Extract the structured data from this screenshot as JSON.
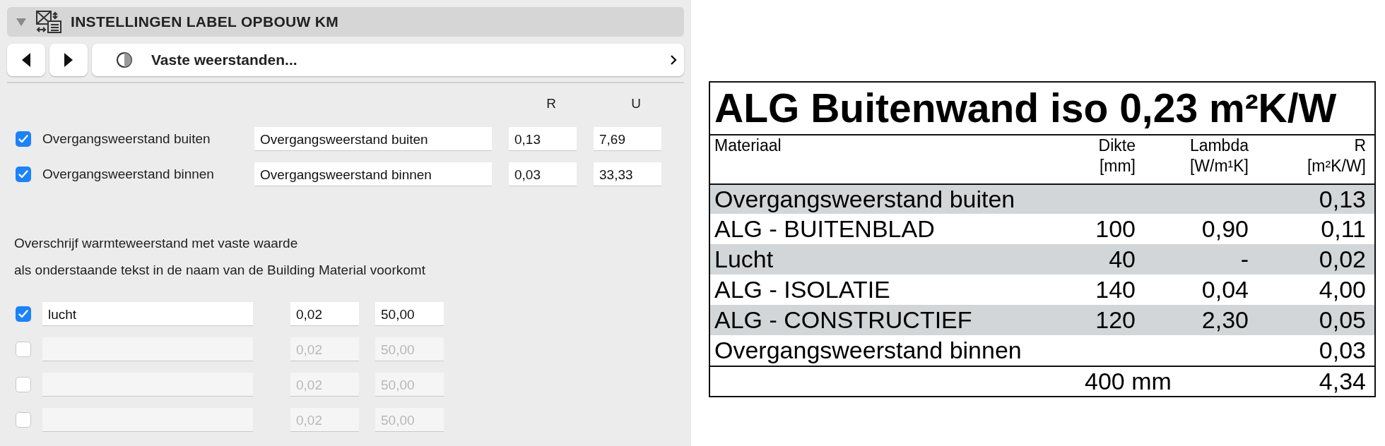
{
  "panel": {
    "title": "INSTELLINGEN LABEL OPBOUW KM",
    "expanded": true,
    "nav": {
      "label": "Vaste weerstanden..."
    },
    "columns": [
      "R",
      "U"
    ],
    "fixed_rows": [
      {
        "label": "Overgangsweerstand buiten",
        "checked": true,
        "name": "Overgangsweerstand buiten",
        "r": "0,13",
        "u": "7,69"
      },
      {
        "label": "Overgangsweerstand binnen",
        "checked": true,
        "name": "Overgangsweerstand binnen",
        "r": "0,03",
        "u": "33,33"
      }
    ],
    "description": [
      "Overschrijf warmteweerstand met vaste waarde",
      "als onderstaande tekst in de naam van de Building Material voorkomt"
    ],
    "override_rows": [
      {
        "checked": true,
        "disabled": false,
        "name": "lucht",
        "r": "0,02",
        "u": "50,00"
      },
      {
        "checked": false,
        "disabled": true,
        "r": "0,02",
        "u": "50,00"
      },
      {
        "checked": false,
        "disabled": true,
        "r": "0,02",
        "u": "50,00"
      },
      {
        "checked": false,
        "disabled": true,
        "r": "0,02",
        "u": "50,00"
      }
    ]
  },
  "label_table": {
    "title": "ALG Buitenwand iso 0,23 m²K/W",
    "columns": [
      {
        "name": "Materiaal"
      },
      {
        "name": "Dikte",
        "unit": "[mm]"
      },
      {
        "name": "Lambda",
        "unit": "[W/m¹K]"
      },
      {
        "name": "R",
        "unit": "[m²K/W]"
      }
    ],
    "rows": [
      {
        "material": "Overgangsweerstand buiten",
        "r": "0,13"
      },
      {
        "material": "ALG - BUITENBLAD",
        "dikte": "100",
        "lambda": "0,90",
        "r": "0,11"
      },
      {
        "material": "Lucht",
        "dikte": "40",
        "lambda": "-",
        "r": "0,02"
      },
      {
        "material": "ALG - ISOLATIE",
        "dikte": "140",
        "lambda": "0,04",
        "r": "4,00"
      },
      {
        "material": "ALG - CONSTRUCTIEF",
        "dikte": "120",
        "lambda": "2,30",
        "r": "0,05"
      },
      {
        "material": "Overgangsweerstand binnen",
        "r": "0,03"
      }
    ],
    "total": {
      "dikte": "400 mm",
      "r": "4,34"
    }
  }
}
